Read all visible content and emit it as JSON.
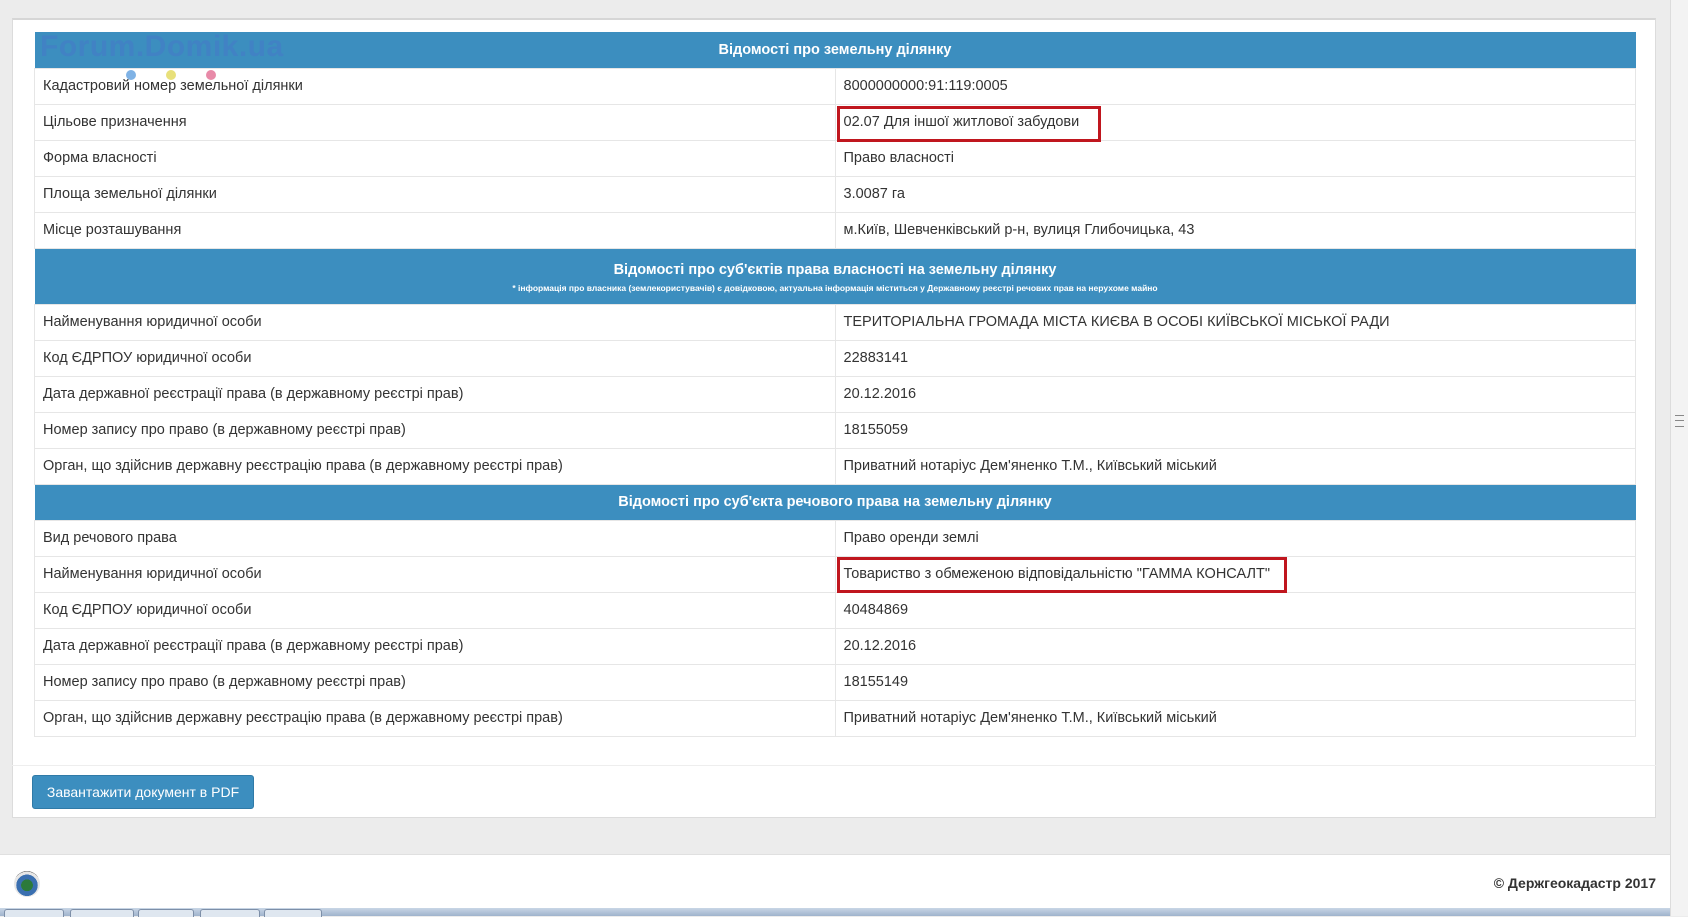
{
  "watermark": "Forum.Domik.ua",
  "section1": {
    "title": "Відомості про земельну ділянку",
    "rows": [
      {
        "label": "Кадастровий номер земельної ділянки",
        "value": "8000000000:91:119:0005"
      },
      {
        "label": "Цільове призначення",
        "value": "02.07 Для іншої житлової забудови"
      },
      {
        "label": "Форма власності",
        "value": "Право власності"
      },
      {
        "label": "Площа земельної ділянки",
        "value": "3.0087 га"
      },
      {
        "label": "Місце розташування",
        "value": "м.Київ, Шевченківський р-н, вулиця Глибочицька, 43"
      }
    ]
  },
  "section2": {
    "title": "Відомості про суб'єктів права власності на земельну ділянку",
    "note": "* інформація про власника (землекористувачів) є довідковою, актуальна інформація міститься у Державному реєстрі речових прав на нерухоме майно",
    "rows": [
      {
        "label": "Найменування юридичної особи",
        "value": "ТЕРИТОРІАЛЬНА ГРОМАДА МІСТА КИЄВА В ОСОБІ КИЇВСЬКОЇ МІСЬКОЇ РАДИ"
      },
      {
        "label": "Код ЄДРПОУ юридичної особи",
        "value": "22883141"
      },
      {
        "label": "Дата державної реєстрації права (в державному реєстрі прав)",
        "value": "20.12.2016"
      },
      {
        "label": "Номер запису про право (в державному реєстрі прав)",
        "value": "18155059"
      },
      {
        "label": "Орган, що здійснив державну реєстрацію права (в державному реєстрі прав)",
        "value": "Приватний нотаріус Дем'яненко Т.М., Київський міський"
      }
    ]
  },
  "section3": {
    "title": "Відомості про суб'єкта речового права на земельну ділянку",
    "rows": [
      {
        "label": "Вид речового права",
        "value": "Право оренди землі"
      },
      {
        "label": "Найменування юридичної особи",
        "value": "Товариство з обмеженою відповідальністю \"ГАММА КОНСАЛТ\""
      },
      {
        "label": "Код ЄДРПОУ юридичної особи",
        "value": "40484869"
      },
      {
        "label": "Дата державної реєстрації права (в державному реєстрі прав)",
        "value": "20.12.2016"
      },
      {
        "label": "Номер запису про право (в державному реєстрі прав)",
        "value": "18155149"
      },
      {
        "label": "Орган, що здійснив державну реєстрацію права (в державному реєстрі прав)",
        "value": "Приватний нотаріус Дем'яненко Т.М., Київський міський"
      }
    ]
  },
  "download_button": "Завантажити документ в PDF",
  "footer": {
    "copyright": "© Держгеокадастр 2017"
  },
  "colors": {
    "header_bg": "#3c8ebf",
    "highlight_border": "#c0161e"
  }
}
